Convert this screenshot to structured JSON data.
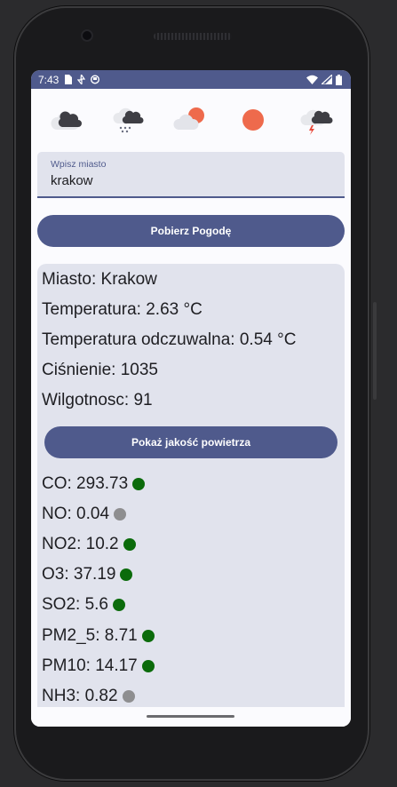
{
  "status": {
    "time": "7:43",
    "left_icons": [
      "sim-card-icon",
      "data-saver-icon",
      "shield-icon"
    ],
    "right_icons": [
      "wifi-icon",
      "signal-icon",
      "battery-icon"
    ]
  },
  "weather_icons": [
    "cloud-rain-icon",
    "cloud-snow-icon",
    "cloud-sun-icon",
    "sun-icon",
    "thunderstorm-icon"
  ],
  "city_input": {
    "label": "Wpisz miasto",
    "value": "krakow"
  },
  "fetch_button": {
    "label": "Pobierz Pogodę"
  },
  "weather": {
    "city": "Miasto: Krakow",
    "temperature": "Temperatura: 2.63 °C",
    "feels_like": "Temperatura odczuwalna: 0.54 °C",
    "pressure": "Ciśnienie: 1035",
    "humidity": "Wilgotnosc: 91"
  },
  "air_button": {
    "label": "Pokaż jakość powietrza"
  },
  "air_quality": [
    {
      "text": "CO: 293.73",
      "status_color": "#0b6b0b"
    },
    {
      "text": "NO: 0.04",
      "status_color": "#8e8e90"
    },
    {
      "text": "NO2: 10.2",
      "status_color": "#0b6b0b"
    },
    {
      "text": "O3: 37.19",
      "status_color": "#0b6b0b"
    },
    {
      "text": "SO2: 5.6",
      "status_color": "#0b6b0b"
    },
    {
      "text": "PM2_5: 8.71",
      "status_color": "#0b6b0b"
    },
    {
      "text": "PM10: 14.17",
      "status_color": "#0b6b0b"
    },
    {
      "text": "NH3: 0.82",
      "status_color": "#8e8e90"
    }
  ],
  "colors": {
    "primary": "#4f5a8c",
    "surface": "#e1e3ed",
    "sun": "#ee6a4c"
  }
}
